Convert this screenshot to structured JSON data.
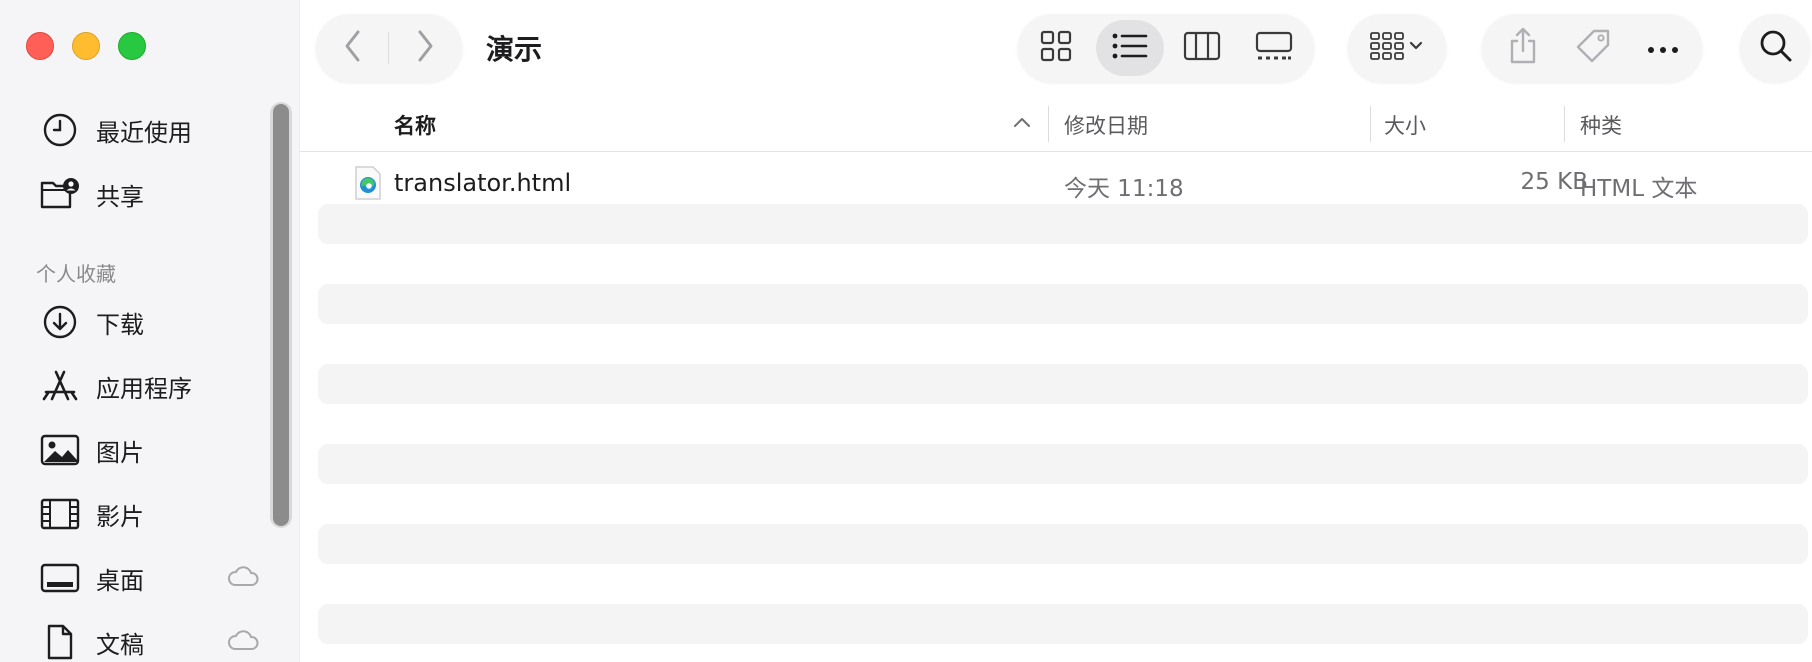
{
  "toolbar": {
    "title": "演示"
  },
  "sidebar": {
    "items_top": [
      {
        "label": "最近使用",
        "icon": "clock-icon"
      },
      {
        "label": "共享",
        "icon": "shared-folder-icon"
      }
    ],
    "section_label": "个人收藏",
    "favorites": [
      {
        "label": "下载",
        "icon": "download-icon"
      },
      {
        "label": "应用程序",
        "icon": "applications-icon"
      },
      {
        "label": "图片",
        "icon": "photo-icon"
      },
      {
        "label": "影片",
        "icon": "film-icon"
      },
      {
        "label": "桌面",
        "icon": "desktop-icon",
        "cloud": true
      },
      {
        "label": "文稿",
        "icon": "document-icon",
        "cloud": true
      }
    ]
  },
  "columns": {
    "name": "名称",
    "date": "修改日期",
    "size": "大小",
    "kind": "种类"
  },
  "files": [
    {
      "name": "translator.html",
      "date": "今天 11:18",
      "size": "25 KB",
      "kind": "HTML 文本"
    }
  ]
}
